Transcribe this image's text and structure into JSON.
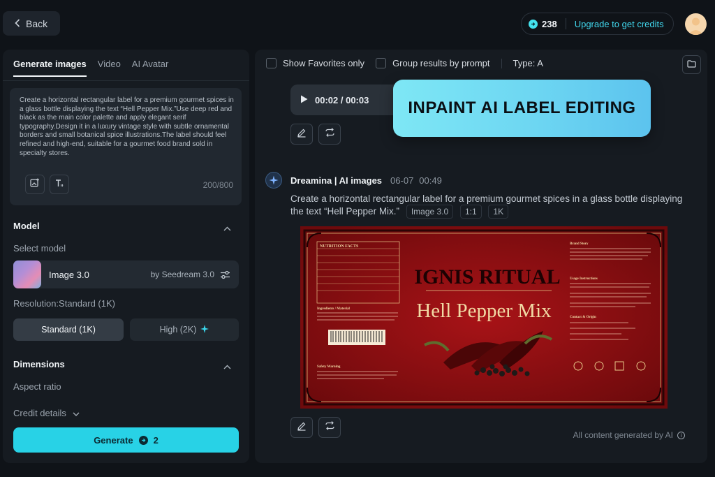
{
  "topbar": {
    "back_label": "Back",
    "credits_count": "238",
    "upgrade_label": "Upgrade to get credits"
  },
  "left": {
    "tabs": [
      "Generate images",
      "Video",
      "AI Avatar"
    ],
    "prompt_text": "Create a horizontal rectangular label for a premium gourmet spices in a glass bottle displaying the text “Hell Pepper Mix.”Use deep red and black as the main color palette and apply elegant serif typography.Design it in a luxury vintage style with subtle ornamental borders and small botanical spice illustrations.The label should feel refined and high-end, suitable for a gourmet food brand sold in specialty stores.",
    "char_counter": "200/800",
    "model_title": "Model",
    "select_model_label": "Select model",
    "model_name": "Image 3.0",
    "model_by": "by Seedream 3.0",
    "resolution_label": "Resolution:Standard (1K)",
    "res_standard": "Standard (1K)",
    "res_high": "High (2K)",
    "dimensions_title": "Dimensions",
    "aspect_ratio_label": "Aspect ratio",
    "credit_details_label": "Credit details",
    "generate_label": "Generate",
    "generate_cost": "2"
  },
  "right": {
    "show_favorites": "Show Favorites only",
    "group_by_prompt": "Group results by prompt",
    "type_filter": "Type: A",
    "audio_time": "00:02 / 00:03",
    "banner_text": "INPAINT AI LABEL EDITING",
    "author": "Dreamina | AI images",
    "date": "06-07",
    "time": "00:49",
    "prompt": "Create a horizontal rectangular label for a premium gourmet spices in a glass bottle displaying the text “Hell Pepper Mix.”",
    "tags": [
      "Image 3.0",
      "1:1",
      "1K"
    ],
    "label_brand": "IGNIS RITUAL",
    "label_product": "Hell Pepper Mix",
    "label_nutrition_title": "NUTRITION FACTS",
    "label_story_title": "Brand Story",
    "label_usage_title": "Usage Instructions",
    "label_contact_title": "Contact & Origin",
    "label_ingredients_title": "Ingredients / Material",
    "label_safety_title": "Safety Warning",
    "footer_note": "All content generated by AI"
  },
  "colors": {
    "accent": "#28d2e6",
    "label_red": "#8d0f12",
    "label_gold": "#e8c98a"
  }
}
